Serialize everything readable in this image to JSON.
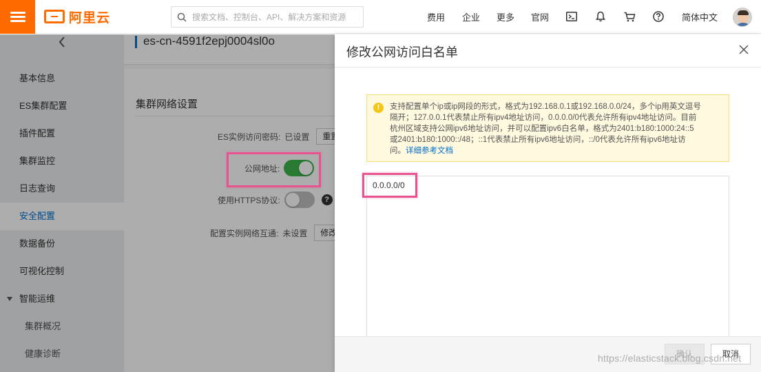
{
  "topbar": {
    "logo_text": "阿里云",
    "search_placeholder": "搜索文档、控制台、API、解决方案和资源",
    "links": [
      "费用",
      "企业",
      "更多",
      "官网"
    ],
    "icons": [
      "terminal-icon",
      "bell-icon",
      "cart-icon",
      "help-icon"
    ],
    "language": "简体中文",
    "accent_color": "#ff6a00"
  },
  "sidebar": {
    "items": [
      {
        "label": "基本信息"
      },
      {
        "label": "ES集群配置"
      },
      {
        "label": "插件配置"
      },
      {
        "label": "集群监控"
      },
      {
        "label": "日志查询"
      },
      {
        "label": "安全配置"
      },
      {
        "label": "数据备份"
      },
      {
        "label": "可视化控制"
      },
      {
        "label": "智能运维"
      },
      {
        "label": "集群概况"
      },
      {
        "label": "健康诊断"
      }
    ],
    "active_color": "#0070cc"
  },
  "main": {
    "instance_id": "es-cn-4591f2epj0004sl0o",
    "section_title": "集群网络设置",
    "password_label": "ES实例访问密码:",
    "password_value": "已设置",
    "reset_button": "重置",
    "public_address_label": "公网地址:",
    "public_address_enabled": true,
    "https_label": "使用HTTPS协议:",
    "https_enabled": false,
    "interconnect_label": "配置实例网络互通:",
    "interconnect_value": "未设置",
    "modify_button": "修改"
  },
  "panel": {
    "title": "修改公网访问白名单",
    "notice_line1": "支持配置单个ip或ip网段的形式，格式为192.168.0.1或192.168.0.0/24，多个ip用英文逗号",
    "notice_line2": "隔开；127.0.0.1代表禁止所有ipv4地址访问，0.0.0.0/0代表允许所有ipv4地址访问。目前",
    "notice_line3": "杭州区域支持公网ipv6地址访问，并可以配置ipv6白名单，格式为2401:b180:1000:24::5",
    "notice_line4": "或2401:b180:1000::/48；::1代表禁止所有ipv6地址访问，::/0代表允许所有ipv6地址访",
    "notice_line5_prefix": "问。",
    "notice_link": "详细参考文档",
    "whitelist_value": "0.0.0.0/0",
    "confirm_button": "确认",
    "cancel_button": "取消"
  },
  "watermark": "https://elasticstack.blog.csdn.net",
  "highlight_color": "#e8538f"
}
